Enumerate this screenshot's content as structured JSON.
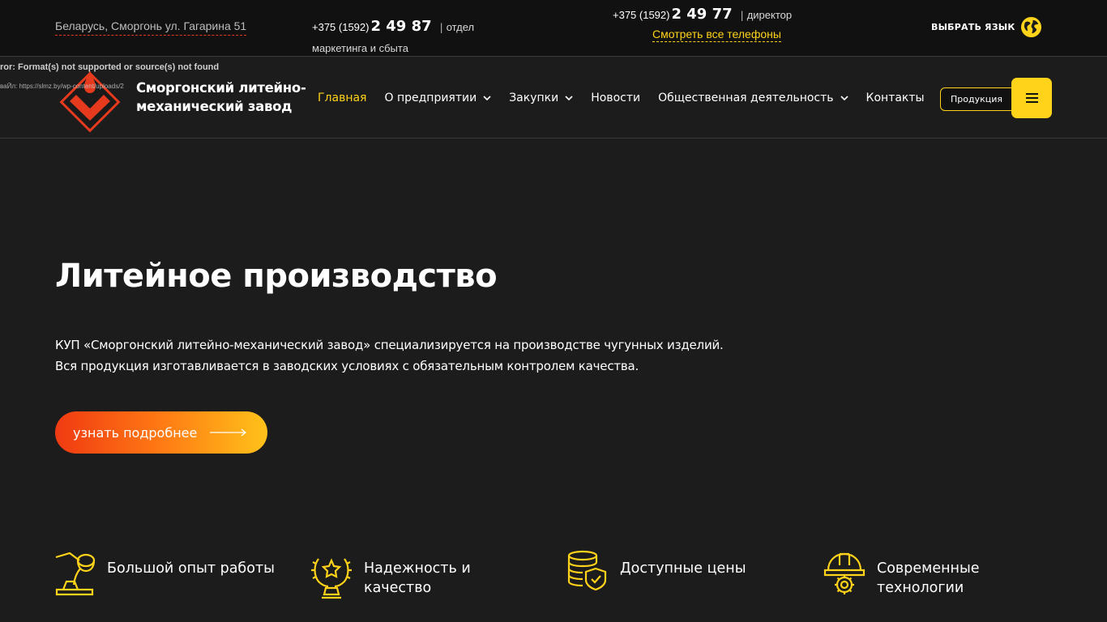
{
  "topbar": {
    "address": "Беларусь, Сморгонь ул. Гагарина 51",
    "phone_marketing": {
      "code": "+375 (1592)",
      "number": "2 49 87",
      "separator": "|",
      "role": "отдел маркетинга и сбыта"
    },
    "phone_director": {
      "code": "+375 (1592)",
      "number": "2 49 77",
      "separator": "|",
      "role": "директор"
    },
    "all_phones_link": "Смотреть все телефоны",
    "language_label": "ВЫБРАТЬ ЯЗЫК",
    "language_icon": "globe-icon"
  },
  "header": {
    "logo_text": "Сморгонский литейно-механический завод",
    "error_line_1": "ror: Format(s) not supported or source(s) not found",
    "error_line_2": "ваЙл: https://slmz.by/wp-content/uploads/2",
    "nav": [
      {
        "label": "Главная",
        "dropdown": false,
        "active": true
      },
      {
        "label": "О предприятии",
        "dropdown": true,
        "active": false
      },
      {
        "label": "Закупки",
        "dropdown": true,
        "active": false
      },
      {
        "label": "Новости",
        "dropdown": false,
        "active": false
      },
      {
        "label": "Общественная деятельность",
        "dropdown": true,
        "active": false
      },
      {
        "label": "Контакты",
        "dropdown": false,
        "active": false
      }
    ],
    "products_button": "Продукция",
    "menu_icon": "hamburger-icon"
  },
  "hero": {
    "title": "Литейное производство",
    "description_line_1": "КУП «Сморгонский литейно-механический завод» специализируется на производстве чугунных изделий.",
    "description_line_2": "Вся продукция изготавливается в заводских условиях с обязательным контролем качества.",
    "cta_label": "узнать подробнее"
  },
  "features": [
    {
      "label": "Большой опыт работы",
      "icon": "ladle-pouring-icon"
    },
    {
      "label": "Надежность и качество",
      "icon": "award-wreath-icon"
    },
    {
      "label": "Доступные цены",
      "icon": "coins-shield-icon"
    },
    {
      "label": "Современные технологии",
      "icon": "hardhat-gear-icon"
    }
  ],
  "colors": {
    "accent_yellow": "#ffd31a",
    "accent_red": "#e53a1e",
    "background": "#1c1c1c",
    "topbar_background": "#111111"
  }
}
